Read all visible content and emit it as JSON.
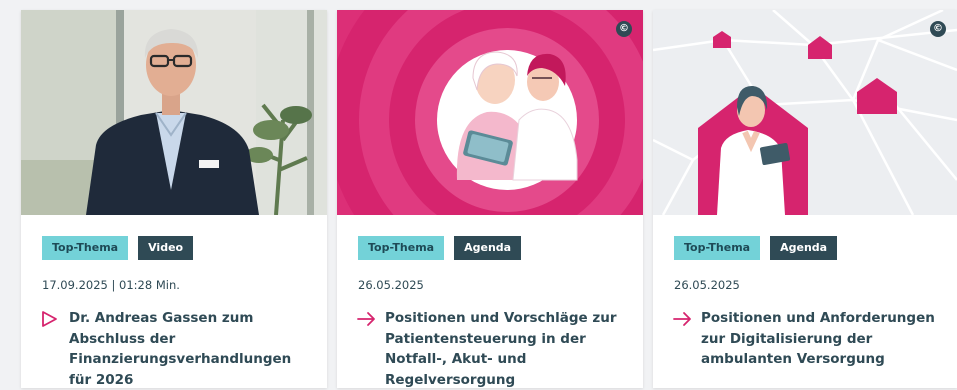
{
  "cards": [
    {
      "tags": [
        "Top-Thema",
        "Video"
      ],
      "meta": "17.09.2025 | 01:28 Min.",
      "title": "Dr. Andreas Gassen zum Abschluss der Finanzierungsverhandlungen für 2026",
      "link_icon": "play-icon",
      "image": "video-speaker-portrait"
    },
    {
      "tags": [
        "Top-Thema",
        "Agenda"
      ],
      "meta": "26.05.2025",
      "title": "Positionen und Vorschläge zur Patientensteuerung in der Notfall-, Akut- und Regelversorgung",
      "link_icon": "arrow-right-icon",
      "image": "doctor-patient-illustration",
      "copyright": "©"
    },
    {
      "tags": [
        "Top-Thema",
        "Agenda"
      ],
      "meta": "26.05.2025",
      "title": "Positionen und Anforderungen zur Digitalisierung der ambulanten Versorgung",
      "link_icon": "arrow-right-icon",
      "image": "doctor-network-illustration",
      "copyright": "©"
    }
  ],
  "colors": {
    "accent": "#d6246e",
    "tag_teal": "#73d2d8",
    "tag_dark": "#2f4a55",
    "text": "#2f4a55"
  }
}
